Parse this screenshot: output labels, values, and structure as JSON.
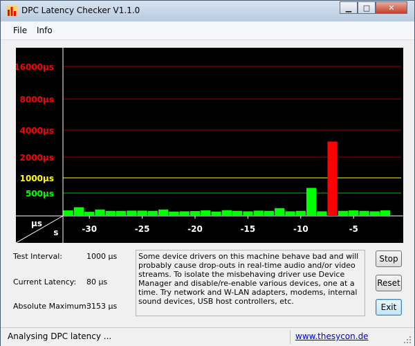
{
  "window": {
    "title": "DPC Latency Checker V1.1.0",
    "controls": {
      "minimize": "▁",
      "maximize": "□",
      "close": "✕"
    }
  },
  "menu": {
    "items": [
      "File",
      "Info"
    ]
  },
  "chart_data": {
    "type": "bar",
    "y_labels": [
      {
        "text": "16000µs",
        "value": 16000,
        "color": "#ff0000"
      },
      {
        "text": "8000µs",
        "value": 8000,
        "color": "#ff0000"
      },
      {
        "text": "4000µs",
        "value": 4000,
        "color": "#ff0000"
      },
      {
        "text": "2000µs",
        "value": 2000,
        "color": "#ff0000"
      },
      {
        "text": "1000µs",
        "value": 1000,
        "color": "#ffff00"
      },
      {
        "text": "500µs",
        "value": 500,
        "color": "#00ff00"
      }
    ],
    "axis_unit_y": "µs",
    "axis_unit_x": "s",
    "x_ticks": [
      "-30",
      "-25",
      "-20",
      "-15",
      "-10",
      "-5"
    ],
    "x_range": [
      -32.5,
      -0.5
    ],
    "bars": [
      {
        "t": -32,
        "value": 120
      },
      {
        "t": -31,
        "value": 190
      },
      {
        "t": -30,
        "value": 90
      },
      {
        "t": -29,
        "value": 140
      },
      {
        "t": -28,
        "value": 110
      },
      {
        "t": -27,
        "value": 110
      },
      {
        "t": -26,
        "value": 115
      },
      {
        "t": -25,
        "value": 115
      },
      {
        "t": -24,
        "value": 110
      },
      {
        "t": -23,
        "value": 140
      },
      {
        "t": -22,
        "value": 95
      },
      {
        "t": -21,
        "value": 100
      },
      {
        "t": -20,
        "value": 105
      },
      {
        "t": -19,
        "value": 120
      },
      {
        "t": -18,
        "value": 95
      },
      {
        "t": -17,
        "value": 125
      },
      {
        "t": -16,
        "value": 110
      },
      {
        "t": -15,
        "value": 100
      },
      {
        "t": -14,
        "value": 115
      },
      {
        "t": -13,
        "value": 110
      },
      {
        "t": -12,
        "value": 170
      },
      {
        "t": -11,
        "value": 100
      },
      {
        "t": -10,
        "value": 110
      },
      {
        "t": -9,
        "value": 670
      },
      {
        "t": -8,
        "value": 100
      },
      {
        "t": -7,
        "value": 3153
      },
      {
        "t": -6,
        "value": 110
      },
      {
        "t": -5,
        "value": 120
      },
      {
        "t": -4,
        "value": 110
      },
      {
        "t": -3,
        "value": 100
      },
      {
        "t": -2,
        "value": 120
      }
    ],
    "colors": {
      "background": "#000000",
      "green": "#00ff00",
      "red": "#ff0000",
      "yellow_line": "#ffff00",
      "red_line": "#a00000"
    }
  },
  "info": {
    "test_interval_label": "Test Interval:",
    "test_interval_value": "1000 µs",
    "current_latency_label": "Current Latency:",
    "current_latency_value": "80 µs",
    "absolute_maximum_label": "Absolute Maximum:",
    "absolute_maximum_value": "3153 µs"
  },
  "description": "Some device drivers on this machine behave bad and will probably cause drop-outs in real-time audio and/or video streams. To isolate the misbehaving driver use Device Manager and disable/re-enable various devices, one at a time. Try network and W-LAN adapters, modems, internal sound devices, USB host controllers, etc.",
  "buttons": {
    "stop": "Stop",
    "reset": "Reset",
    "exit": "Exit"
  },
  "status": {
    "text": "Analysing DPC latency ...",
    "link": "www.thesycon.de"
  }
}
